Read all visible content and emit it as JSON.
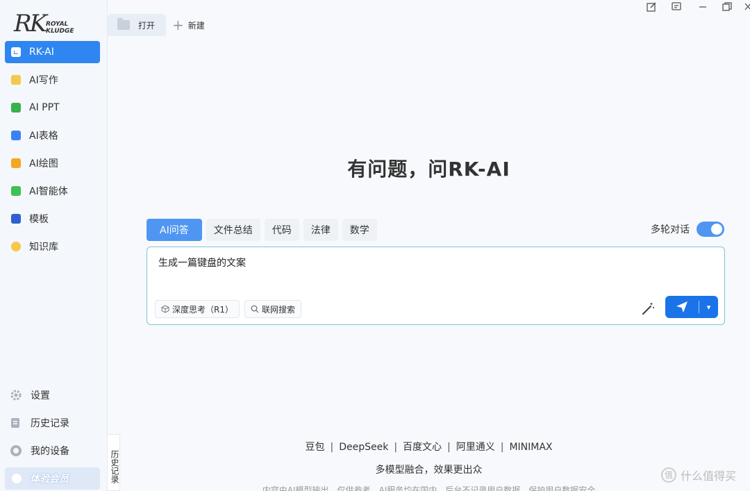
{
  "brand": {
    "logo_initials": "RK",
    "logo_line1": "ROYAL",
    "logo_line2": "KLUDGE"
  },
  "sidebar": {
    "items": [
      {
        "label": "RK-AI",
        "icon": "rk-ai-icon",
        "color": "#ffffff",
        "active": true
      },
      {
        "label": "AI写作",
        "icon": "writing-icon",
        "color": "#f5c84a"
      },
      {
        "label": "AI PPT",
        "icon": "ppt-icon",
        "color": "#37b24d"
      },
      {
        "label": "AI表格",
        "icon": "sheet-icon",
        "color": "#3b82f6"
      },
      {
        "label": "AI绘图",
        "icon": "palette-icon",
        "color": "#f5a623"
      },
      {
        "label": "AI智能体",
        "icon": "agent-icon",
        "color": "#40c057"
      },
      {
        "label": "模板",
        "icon": "template-icon",
        "color": "#2f5fd0"
      },
      {
        "label": "知识库",
        "icon": "bulb-icon",
        "color": "#f5c84a"
      }
    ],
    "bottom": {
      "settings": "设置",
      "history": "历史记录",
      "devices": "我的设备",
      "member": "体验会员"
    },
    "history_tab": "历史记录"
  },
  "tabbar": {
    "open_label": "打开",
    "new_label": "新建"
  },
  "main": {
    "headline": "有问题，问RK-AI",
    "modes": [
      "AI问答",
      "文件总结",
      "代码",
      "法律",
      "数学"
    ],
    "multi_turn_label": "多轮对话",
    "multi_turn_on": true,
    "input_text": "生成一篇键盘的文案",
    "chip_deep_think": "深度思考（R1）",
    "chip_web_search": "联网搜索"
  },
  "footer": {
    "providers": [
      "豆包",
      "DeepSeek",
      "百度文心",
      "阿里通义",
      "MINIMAX"
    ],
    "separator": "|",
    "slogan": "多模型融合，效果更出众",
    "disclaimer": "内容由AI模型输出，仅供参考　AI服务均在国内，后台不记录用户数据，保护用户数据安全"
  },
  "watermark": "什么值得买",
  "colors": {
    "accent": "#2f86f0",
    "send": "#1a73e8",
    "toggle": "#4f96f2"
  }
}
